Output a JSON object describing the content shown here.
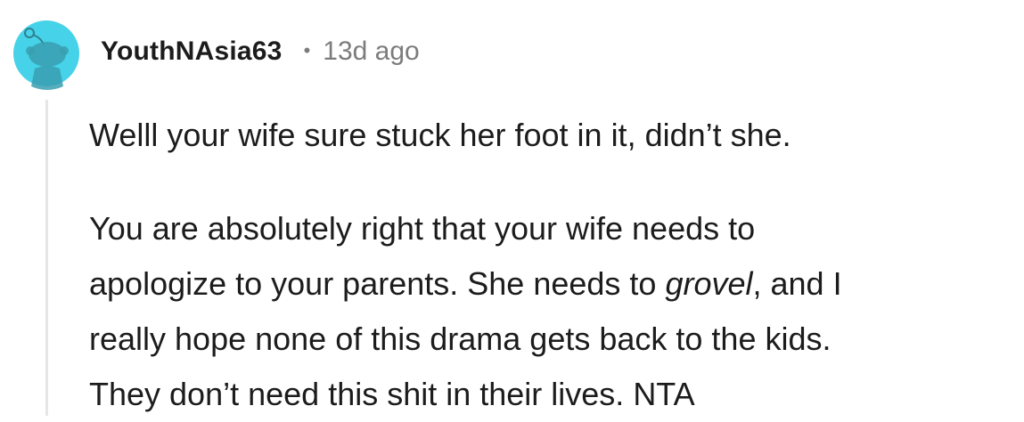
{
  "comment": {
    "author": {
      "username": "YouthNAsia63",
      "avatar_icon": "snoo-avatar-icon",
      "avatar_color": "#46d2e8"
    },
    "separator": "•",
    "timestamp": "13d ago",
    "body": {
      "paragraph_1": "Welll your wife sure stuck her foot in it, didn’t she.",
      "paragraph_2": {
        "line_1": "You are absolutely right that your wife needs to",
        "line_2_before": "apologize to your parents. She needs to ",
        "line_2_emphasis": "grovel",
        "line_2_after": ", and I",
        "line_3": "really hope none of this drama gets back to the kids.",
        "line_4": "They don’t need this shit in their lives. NTA"
      }
    }
  },
  "colors": {
    "text": "#1c1c1c",
    "meta": "#7c7c7c",
    "thread_line": "#e4e6e8"
  }
}
